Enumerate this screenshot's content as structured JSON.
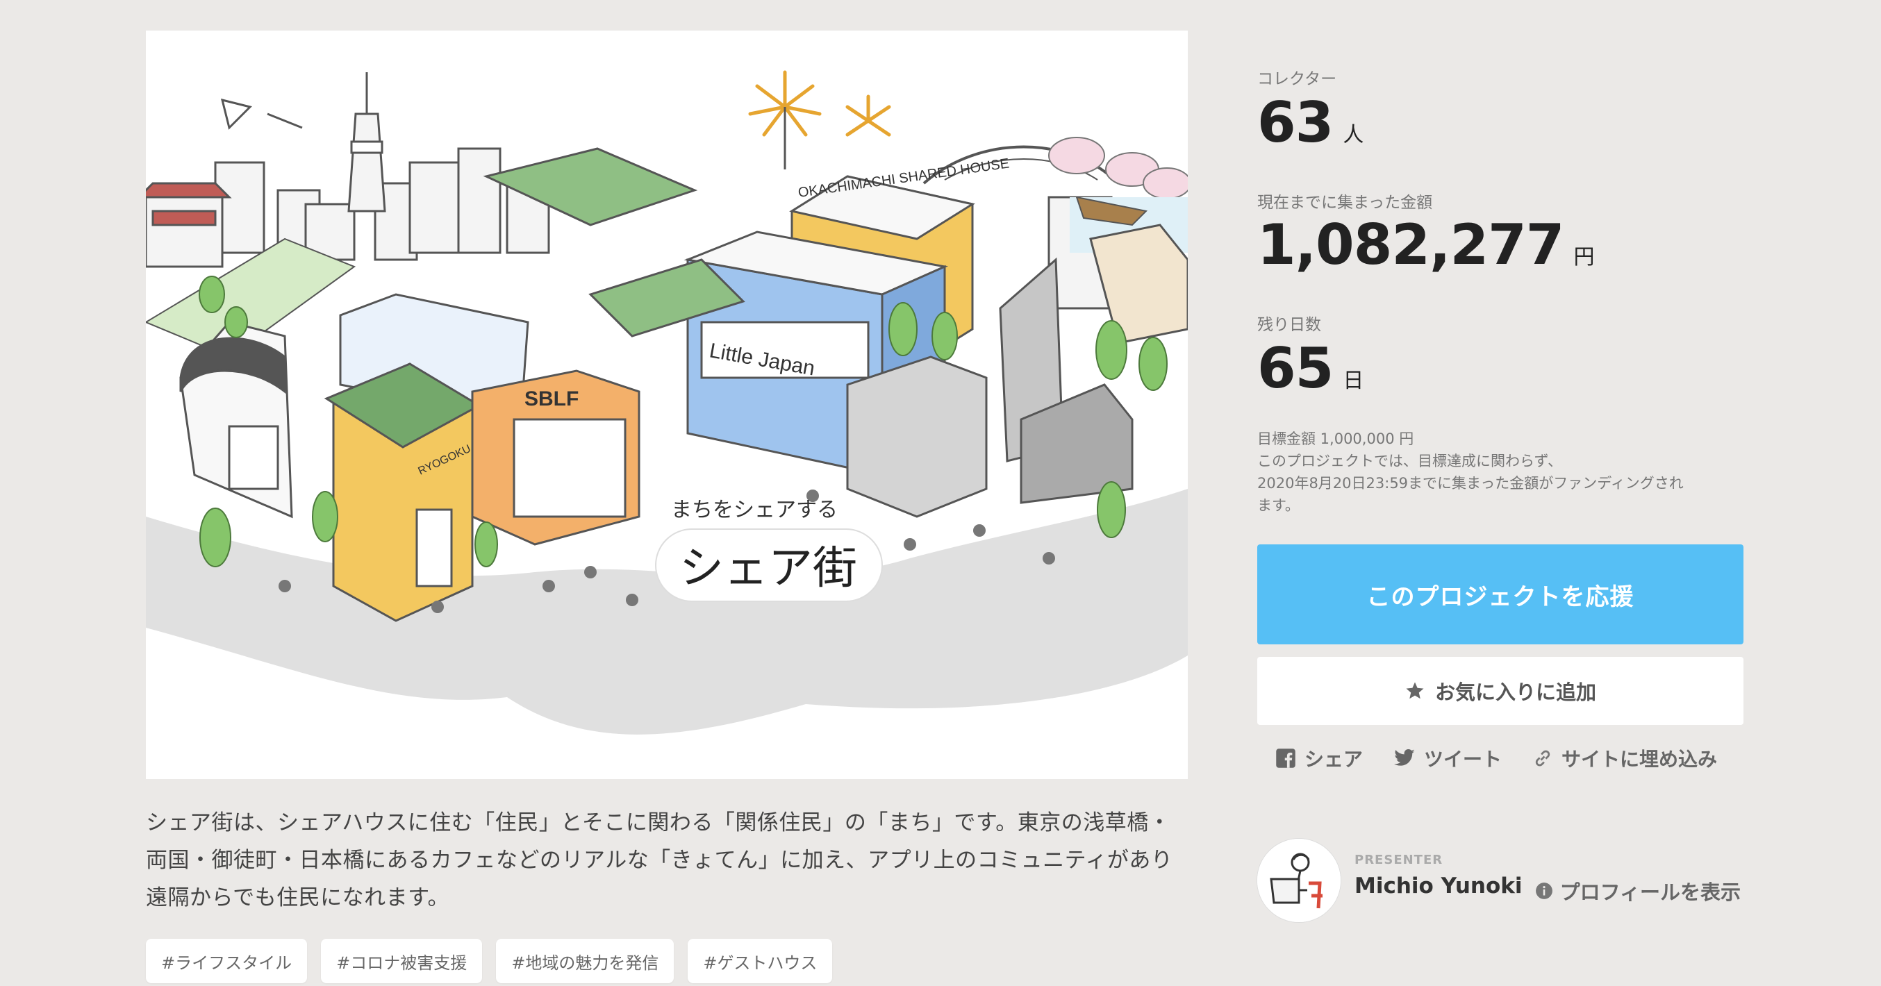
{
  "stats": {
    "collectors_label": "コレクター",
    "collectors_value": "63",
    "collectors_unit": "人",
    "raised_label": "現在までに集まった金額",
    "raised_value": "1,082,277",
    "raised_unit": "円",
    "days_label": "残り日数",
    "days_value": "65",
    "days_unit": "日"
  },
  "note": {
    "goal": "目標金額 1,000,000 円",
    "line1": "このプロジェクトでは、目標達成に関わらず、",
    "line2": "2020年8月20日23:59までに集まった金額がファンディングされ",
    "line3": "ます。"
  },
  "buttons": {
    "support": "このプロジェクトを応援",
    "favorite": "お気に入りに追加"
  },
  "share": {
    "facebook": "シェア",
    "twitter": "ツイート",
    "embed": "サイトに埋め込み"
  },
  "presenter": {
    "label": "PRESENTER",
    "name": "Michio Yunoki",
    "profile": "プロフィールを表示"
  },
  "hero": {
    "subtitle": "まちをシェアする",
    "title": "シェア街",
    "sign_okachimachi": "OKACHIMACHI SHARED HOUSE",
    "sign_little_japan": "Little Japan",
    "sign_sblf": "SBLF",
    "sign_ryogoku": "RYOGOKU SHARED HOUSE"
  },
  "description": "シェア街は、シェアハウスに住む「住民」とそこに関わる「関係住民」の「まち」です。東京の浅草橋・両国・御徒町・日本橋にあるカフェなどのリアルな「きょてん」に加え、アプリ上のコミュニティがあり遠隔からでも住民になれます。",
  "tags": [
    "#ライフスタイル",
    "#コロナ被害支援",
    "#地域の魅力を発信",
    "#ゲストハウス"
  ],
  "colors": {
    "accent": "#56bff5",
    "background": "#ebe9e7"
  }
}
